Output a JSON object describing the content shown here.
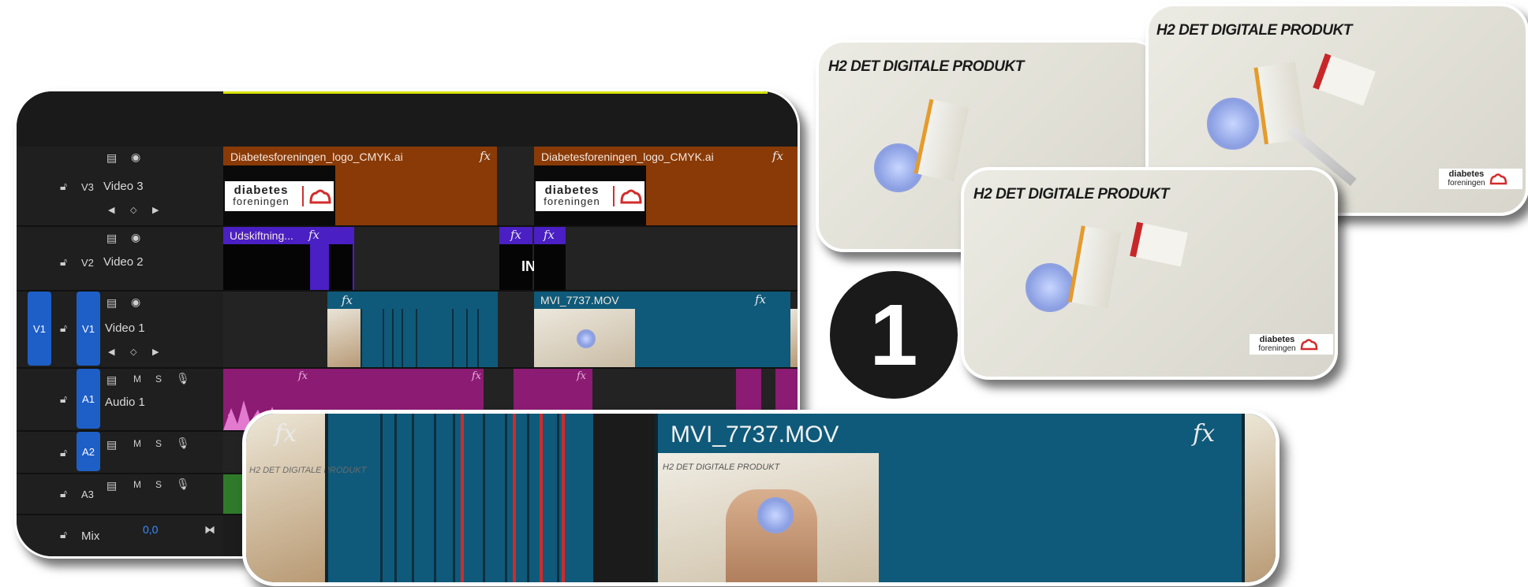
{
  "timeline": {
    "tracks": [
      {
        "id": "V3",
        "name": "Video 3"
      },
      {
        "id": "V2",
        "name": "Video 2"
      },
      {
        "id": "V1",
        "name": "Video 1",
        "source": "V1"
      },
      {
        "id": "A1",
        "name": "Audio 1",
        "m": "M",
        "s": "S"
      },
      {
        "id": "A2",
        "m": "M",
        "s": "S"
      },
      {
        "id": "A3",
        "m": "M",
        "s": "S"
      }
    ],
    "mix": {
      "label": "Mix",
      "value": "0,0"
    },
    "clips": {
      "logo_a": "Diabetesforeningen_logo_CMYK.ai",
      "logo_b": "Diabetesforeningen_logo_CMYK.ai",
      "udskift": "Udskiftning...",
      "mvi": "MVI_7737.MOV",
      "in_text": "IN",
      "audio_marker": "1"
    },
    "fx": "fx",
    "logo": {
      "line1": "diabetes",
      "line2": "foreningen"
    }
  },
  "zoom": {
    "fx": "fx",
    "clip_name": "MVI_7737.MOV",
    "thumb_caption": "H2 DET DIGITALE PRODUKT"
  },
  "photos": {
    "heading": "H2 DET DIGITALE PRODUKT",
    "watermark": {
      "line1": "diabetes",
      "line2": "foreningen"
    }
  },
  "badge": "1"
}
